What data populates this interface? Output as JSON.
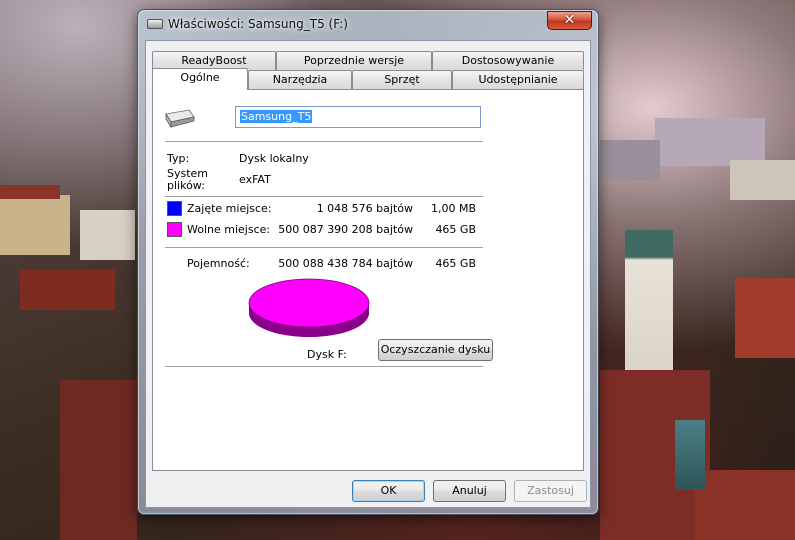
{
  "window": {
    "title": "Właściwości: Samsung_T5 (F:)",
    "close_label": "✕"
  },
  "tabs_row1": [
    {
      "label": "ReadyBoost"
    },
    {
      "label": "Poprzednie wersje"
    },
    {
      "label": "Dostosowywanie"
    }
  ],
  "tabs_row2": [
    {
      "label": "Ogólne",
      "active": true
    },
    {
      "label": "Narzędzia"
    },
    {
      "label": "Sprzęt"
    },
    {
      "label": "Udostępnianie"
    }
  ],
  "general": {
    "drive_name": "Samsung_T5",
    "drive_icon": "drive-icon",
    "type_label": "Typ:",
    "type_value": "Dysk lokalny",
    "fs_label_line1": "System",
    "fs_label_line2": "plików:",
    "fs_value": "exFAT",
    "used": {
      "label": "Zajęte miejsce:",
      "bytes": "1 048 576 bajtów",
      "size": "1,00 MB",
      "color": "#0000ff"
    },
    "free": {
      "label": "Wolne miejsce:",
      "bytes": "500 087 390 208 bajtów",
      "size": "465 GB",
      "color": "#ff00ff"
    },
    "capacity": {
      "label": "Pojemność:",
      "bytes": "500 088 438 784 bajtów",
      "size": "465 GB"
    },
    "disk_label": "Dysk F:",
    "cleanup_button": "Oczyszczanie dysku"
  },
  "footer": {
    "ok": "OK",
    "cancel": "Anuluj",
    "apply": "Zastosuj"
  }
}
